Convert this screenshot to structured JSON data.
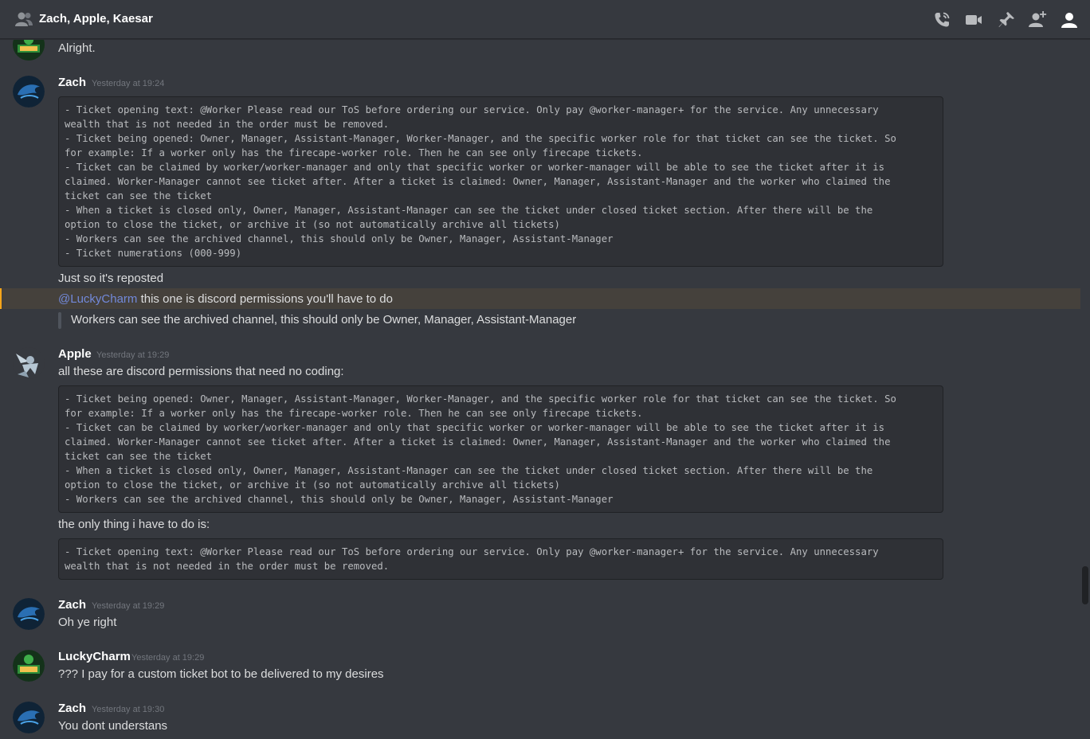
{
  "header": {
    "title": "Zach, Apple, Kaesar",
    "icons": [
      "call-icon",
      "video-icon",
      "pin-icon",
      "add-member-icon",
      "member-list-icon"
    ]
  },
  "messages": [
    {
      "lines": [
        "Alright."
      ]
    },
    {
      "author": "Zach",
      "timestamp": "Yesterday at 19:24",
      "code": [
        "- Ticket opening text: @Worker Please read our ToS before ordering our service. Only pay @worker-manager+ for the service. Any unnecessary",
        "wealth that is not needed in the order must be removed.",
        "- Ticket being opened: Owner, Manager, Assistant-Manager, Worker-Manager, and the specific worker role for that ticket can see the ticket. So",
        "for example: If a worker only has the firecape-worker role. Then he can see only firecape tickets.",
        "- Ticket can be claimed by worker/worker-manager and only that specific worker or worker-manager will be able to see the ticket after it is",
        "claimed. Worker-Manager cannot see ticket after. After a ticket is claimed: Owner, Manager, Assistant-Manager and the worker who claimed the",
        "ticket can see the ticket",
        "- When a ticket is closed only, Owner, Manager, Assistant-Manager can see the ticket under closed ticket section. After there will be the",
        "option to close the ticket, or archive it (so not automatically archive all tickets)",
        "- Workers can see the archived channel, this should only be Owner, Manager, Assistant-Manager",
        "- Ticket numerations (000-999)"
      ],
      "after": "Just so it's reposted",
      "mention": "@LuckyCharm",
      "mention_text": " this one is discord permissions you'll have to do",
      "quote": "Workers can see the archived channel, this should only be Owner, Manager, Assistant-Manager"
    },
    {
      "author": "Apple",
      "timestamp": "Yesterday at 19:29",
      "text": "all these are discord permissions that need no coding:",
      "code": [
        "- Ticket being opened: Owner, Manager, Assistant-Manager, Worker-Manager, and the specific worker role for that ticket can see the ticket. So",
        "for example: If a worker only has the firecape-worker role. Then he can see only firecape tickets.",
        "- Ticket can be claimed by worker/worker-manager and only that specific worker or worker-manager will be able to see the ticket after it is",
        "claimed. Worker-Manager cannot see ticket after. After a ticket is claimed: Owner, Manager, Assistant-Manager and the worker who claimed the",
        "ticket can see the ticket",
        "- When a ticket is closed only, Owner, Manager, Assistant-Manager can see the ticket under closed ticket section. After there will be the",
        "option to close the ticket, or archive it (so not automatically archive all tickets)",
        "- Workers can see the archived channel, this should only be Owner, Manager, Assistant-Manager"
      ],
      "text2": "the only thing i have to do is:",
      "code2": [
        "- Ticket opening text: @Worker Please read our ToS before ordering our service. Only pay @worker-manager+ for the service. Any unnecessary",
        "wealth that is not needed in the order must be removed."
      ]
    },
    {
      "author": "Zach",
      "timestamp": "Yesterday at 19:29",
      "text": "Oh ye right"
    },
    {
      "author": "LuckyCharm",
      "timestamp": "Yesterday at 19:29",
      "text": "??? I pay for a custom ticket bot to be delivered to my desires"
    },
    {
      "author": "Zach",
      "timestamp": "Yesterday at 19:30",
      "text": "You dont understans"
    }
  ],
  "colors": {
    "background": "#36393f",
    "mention": "#7289da",
    "highlight": "#faa61a",
    "codeblock": "#2f3136"
  }
}
